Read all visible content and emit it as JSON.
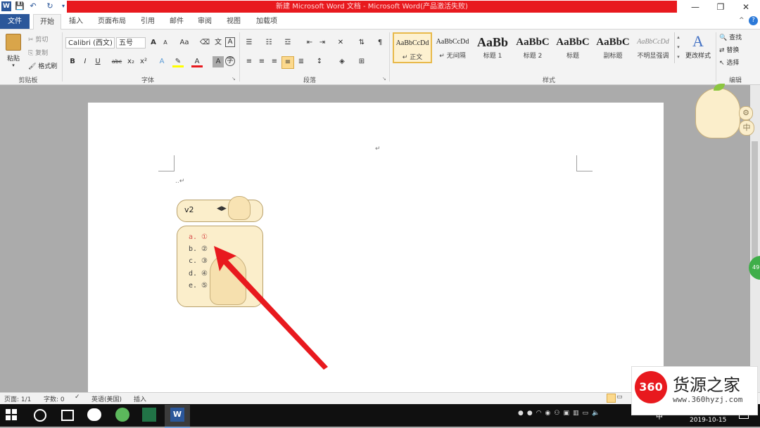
{
  "titlebar": {
    "title": "新建 Microsoft Word 文档 - Microsoft Word(产品激活失败)",
    "app_icon": "W"
  },
  "tabs": [
    "文件",
    "开始",
    "插入",
    "页面布局",
    "引用",
    "邮件",
    "审阅",
    "视图",
    "加载项"
  ],
  "clipboard": {
    "paste": "粘贴",
    "cut": "剪切",
    "copy": "复制",
    "format_painter": "格式刷",
    "group": "剪贴板"
  },
  "font": {
    "name": "Calibri (西文)",
    "size": "五号",
    "group": "字体",
    "grow": "A",
    "shrink": "A",
    "case": "Aa",
    "bold": "B",
    "italic": "I",
    "underline": "U",
    "strike": "abc",
    "sub": "x₂",
    "sup": "x²"
  },
  "paragraph": {
    "group": "段落"
  },
  "styles": {
    "group": "样式",
    "items": [
      {
        "preview": "AaBbCcDd",
        "name": "↵ 正文"
      },
      {
        "preview": "AaBbCcDd",
        "name": "↵ 无间隔"
      },
      {
        "preview": "AaBb",
        "name": "标题 1"
      },
      {
        "preview": "AaBbC",
        "name": "标题 2"
      },
      {
        "preview": "AaBbC",
        "name": "标题"
      },
      {
        "preview": "AaBbC",
        "name": "副标题"
      },
      {
        "preview": "AaBbCcDd",
        "name": "不明显强调"
      }
    ],
    "change": "更改样式"
  },
  "editing": {
    "find": "查找",
    "replace": "替换",
    "select": "选择",
    "group": "编辑"
  },
  "document": {
    "mark1": "↵",
    "mark2": "..↵"
  },
  "ime": {
    "input": "v2",
    "candidates": [
      "a. ①",
      "b. ②",
      "c. ③",
      "d. ④",
      "e. ⑤"
    ],
    "side_lang": "中"
  },
  "statusbar": {
    "page": "页面: 1/1",
    "words": "字数: 0",
    "lang": "英语(美国)",
    "mode": "插入"
  },
  "taskbar": {
    "time": "",
    "date": "2019-10-15",
    "ime": "中"
  },
  "watermark": {
    "logo": "360",
    "name": "货源之家",
    "url": "www.360hyzj.com"
  },
  "side_badge": "49",
  "colors": {
    "file_tab": "#2b579a",
    "title_red": "#e8191e",
    "arrow": "#e8191e",
    "ime_bg": "#fbeecb",
    "candidate_selected": "#d9534f"
  }
}
